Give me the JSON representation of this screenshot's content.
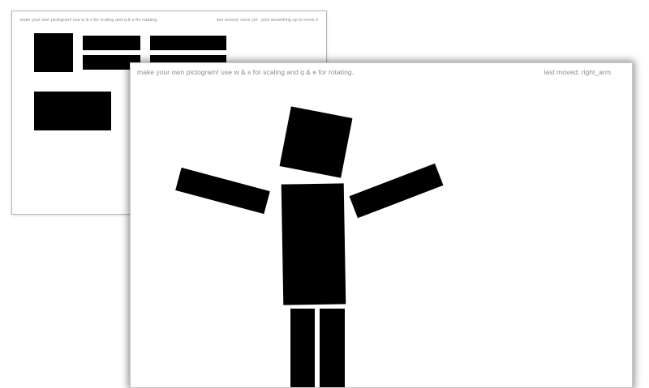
{
  "colors": {
    "page_background": "#ffffff",
    "piece_fill": "#000000",
    "text_gray": "#8e8e8e"
  },
  "back_window": {
    "instructions": "make your own pictogram! use w & s for scaling and q & e for rotating.",
    "status": "last moved: none yet - pick something up to move it"
  },
  "front_window": {
    "instructions": "make your own pictogram! use w & s for scaling and q & e for rotating.",
    "status": "last moved: right_arm"
  }
}
